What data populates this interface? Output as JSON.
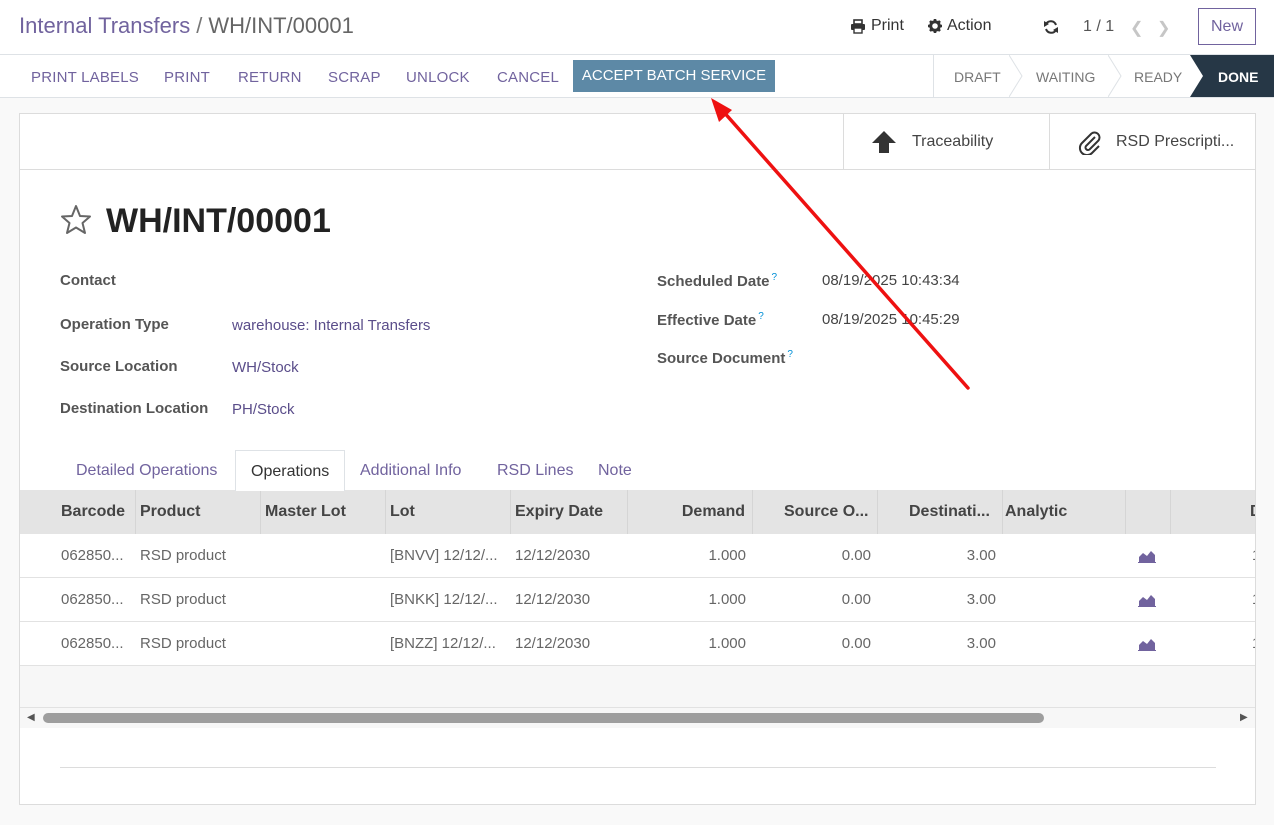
{
  "breadcrumb": {
    "parent": "Internal Transfers",
    "separator": "/",
    "current": "WH/INT/00001"
  },
  "control": {
    "print_label": "Print",
    "action_label": "Action",
    "pager": "1 / 1",
    "new_label": "New"
  },
  "actions": [
    "PRINT LABELS",
    "PRINT",
    "RETURN",
    "SCRAP",
    "UNLOCK",
    "CANCEL"
  ],
  "primary_action": "ACCEPT BATCH SERVICE",
  "states": [
    "DRAFT",
    "WAITING",
    "READY",
    "DONE"
  ],
  "current_state": "DONE",
  "smart_buttons": {
    "traceability": "Traceability",
    "rsd": "RSD Prescripti..."
  },
  "record": {
    "title": "WH/INT/00001",
    "left_fields": [
      {
        "label": "Contact",
        "value": ""
      },
      {
        "label": "Operation Type",
        "value": "warehouse: Internal Transfers"
      },
      {
        "label": "Source Location",
        "value": "WH/Stock"
      },
      {
        "label": "Destination Location",
        "value": "PH/Stock"
      }
    ],
    "right_fields": [
      {
        "label": "Scheduled Date",
        "value": "08/19/2025 10:43:34"
      },
      {
        "label": "Effective Date",
        "value": "08/19/2025 10:45:29"
      },
      {
        "label": "Source Document",
        "value": ""
      }
    ],
    "help_mark": "?"
  },
  "tabs": [
    "Detailed Operations",
    "Operations",
    "Additional Info",
    "RSD Lines",
    "Note"
  ],
  "active_tab": "Operations",
  "table": {
    "columns": [
      "Barcode",
      "Product",
      "Master Lot",
      "Lot",
      "Expiry Date",
      "Demand",
      "Source O...",
      "Destinati...",
      "Analytic",
      "D"
    ],
    "rows": [
      {
        "barcode": "062850...",
        "product": "RSD product",
        "master_lot": "",
        "lot": "[BNVV] 12/12/...",
        "expiry": "12/12/2030",
        "demand": "1.000",
        "source": "0.00",
        "dest": "3.00",
        "extra": "1"
      },
      {
        "barcode": "062850...",
        "product": "RSD product",
        "master_lot": "",
        "lot": "[BNKK] 12/12/...",
        "expiry": "12/12/2030",
        "demand": "1.000",
        "source": "0.00",
        "dest": "3.00",
        "extra": "1"
      },
      {
        "barcode": "062850...",
        "product": "RSD product",
        "master_lot": "",
        "lot": "[BNZZ] 12/12/...",
        "expiry": "12/12/2030",
        "demand": "1.000",
        "source": "0.00",
        "dest": "3.00",
        "extra": "1"
      }
    ]
  },
  "colors": {
    "brand": "#71639e",
    "primary_button": "#5d89a6",
    "done_state": "#263746",
    "arrow": "#ee0000"
  },
  "icons": [
    "print-icon",
    "gear-icon",
    "refresh-icon",
    "chevron-left-icon",
    "chevron-right-icon",
    "arrow-up-icon",
    "paperclip-icon",
    "star-icon",
    "area-chart-icon"
  ]
}
